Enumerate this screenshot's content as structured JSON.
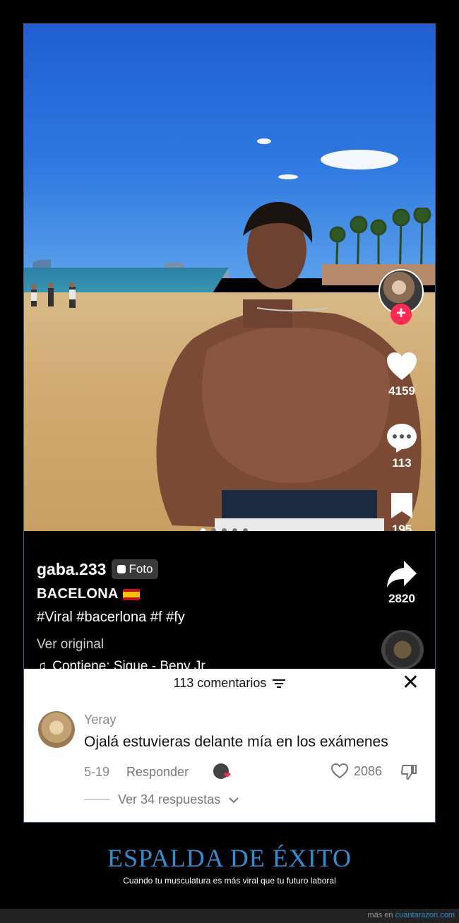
{
  "post": {
    "username": "gaba.233",
    "badge_label": "Foto",
    "title": "BACELONA",
    "hashtags": "#Viral #bacerlona #f #fy",
    "ver_original": "Ver original",
    "music": "Contiene: Sigue - Beny Jr",
    "follow_symbol": "+"
  },
  "actions": {
    "likes": "4159",
    "comments": "113",
    "saves": "195",
    "shares": "2820"
  },
  "carousel": {
    "total": 5,
    "active_index": 0
  },
  "comments_panel": {
    "header": "113 comentarios",
    "close_symbol": "✕",
    "comment": {
      "author": "Yeray",
      "text": "Ojalá estuvieras delante mía en los exámenes",
      "date": "5-19",
      "reply_label": "Responder",
      "likes": "2086",
      "replies_label": "Ver 34 respuestas"
    }
  },
  "meme": {
    "title": "ESPALDA DE ÉXITO",
    "subtitle": "Cuando tu musculatura es más viral que tu futuro laboral"
  },
  "footer": {
    "prefix": "más en",
    "site": "cuantarazon.com"
  },
  "colors": {
    "accent_red": "#fe2c55",
    "meme_blue": "#2f8fd0"
  }
}
